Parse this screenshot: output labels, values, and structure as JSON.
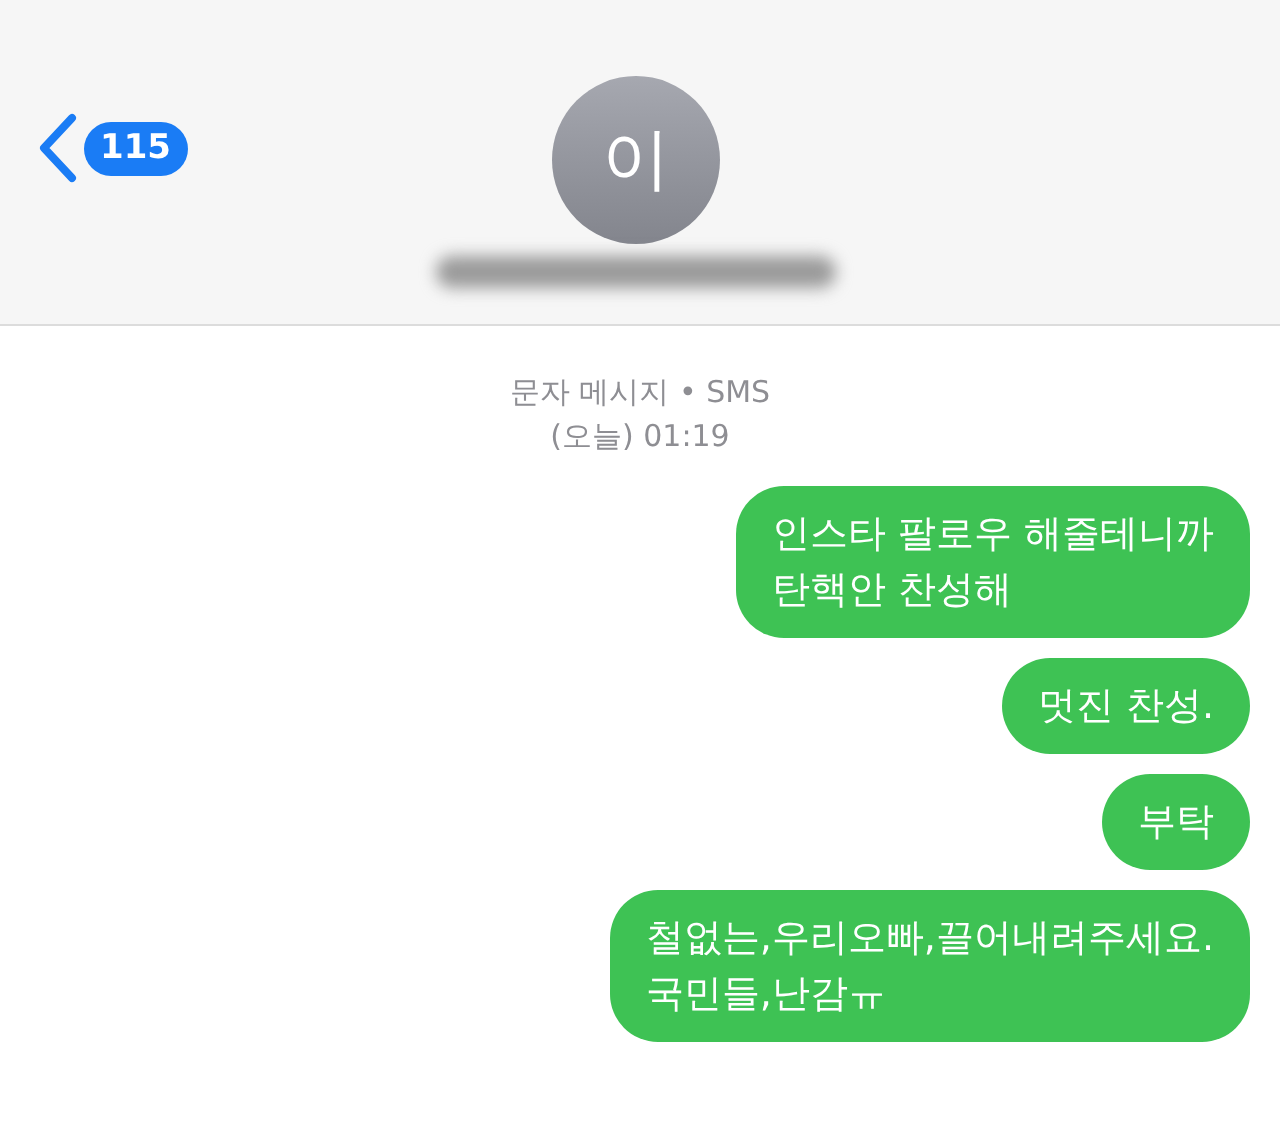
{
  "header": {
    "back_count": "115",
    "avatar_initial": "이"
  },
  "thread_info": {
    "service": "문자 메시지 • SMS",
    "time": "(오늘) 01:19"
  },
  "messages": [
    {
      "lines": [
        "인스타 팔로우 해줄테니까",
        "탄핵안 찬성해"
      ]
    },
    {
      "lines": [
        "멋진 찬성."
      ]
    },
    {
      "lines": [
        "부탁"
      ]
    },
    {
      "lines": [
        "철없는,우리오빠,끌어내려주세요.",
        "국민들,난감ㅠ"
      ]
    }
  ]
}
